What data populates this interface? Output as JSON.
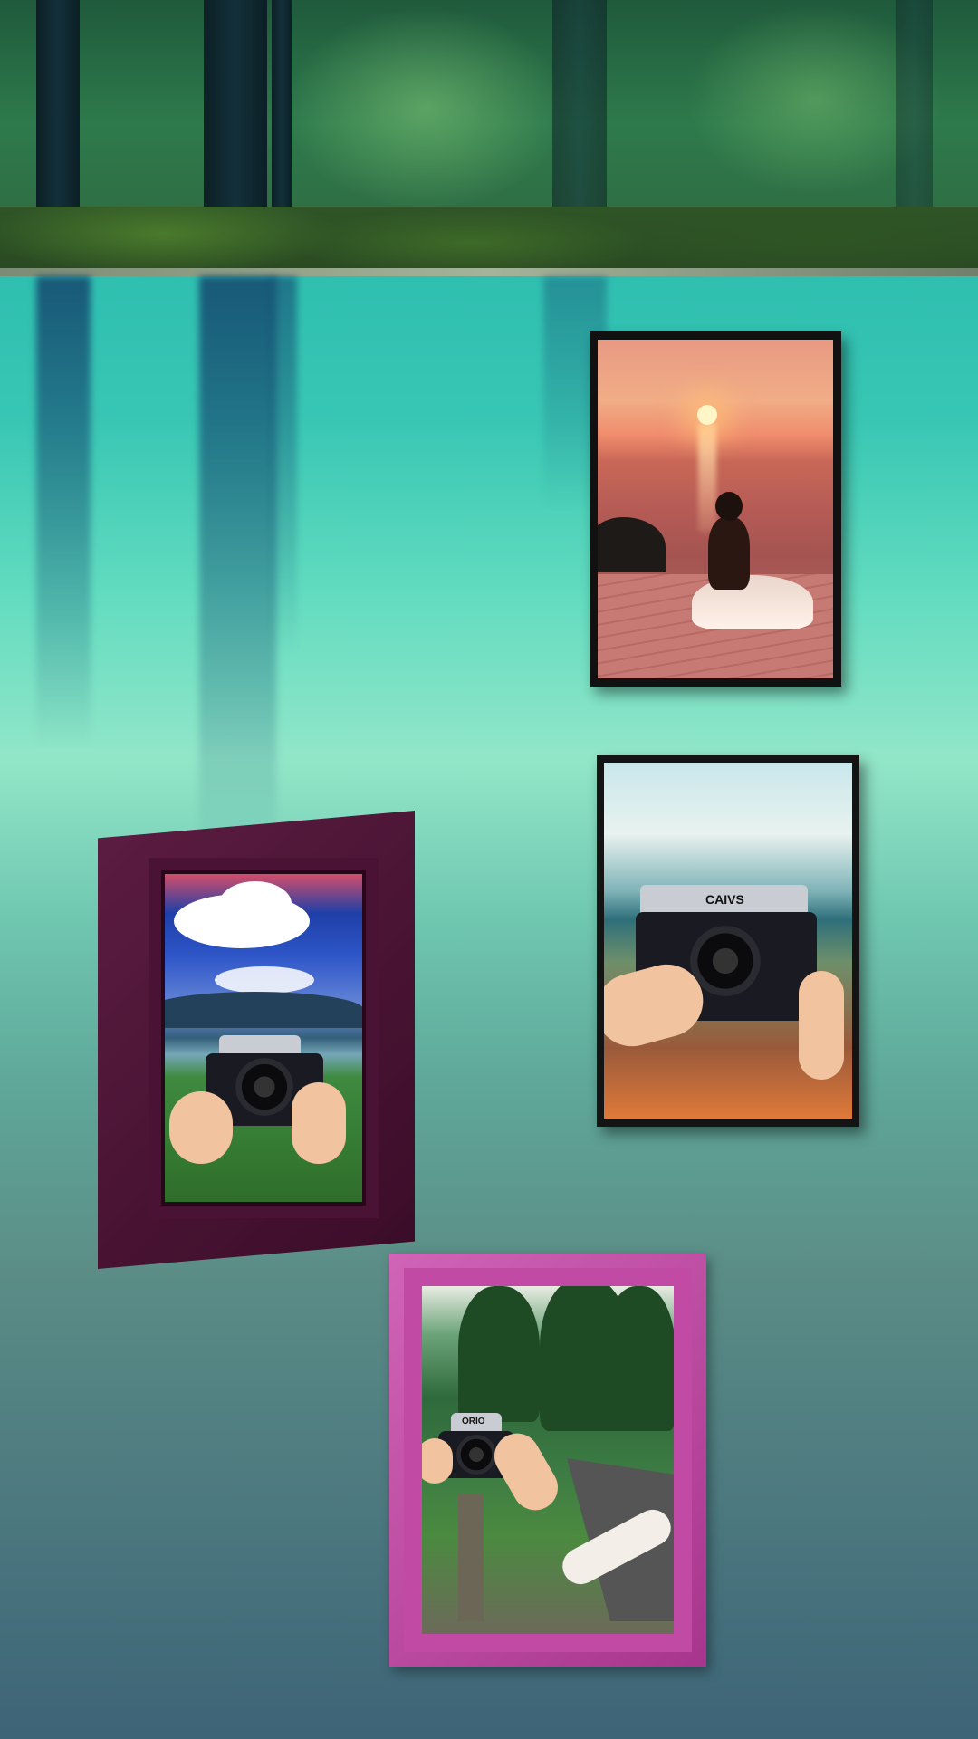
{
  "scene": {
    "description_icons": [
      "forest-icon",
      "lake-icon",
      "picture-frame-icon"
    ],
    "colors": {
      "water_top": "#2fbfb0",
      "water_mid": "#92e6c8",
      "water_bottom": "#3d6477",
      "frame_dark_purple": "#4a1234",
      "frame_pink": "#c14aa4",
      "frame_black": "#111111"
    }
  },
  "photos": {
    "camera_label_right": "CAIVS",
    "camera_label_bottom": "ORIO"
  }
}
